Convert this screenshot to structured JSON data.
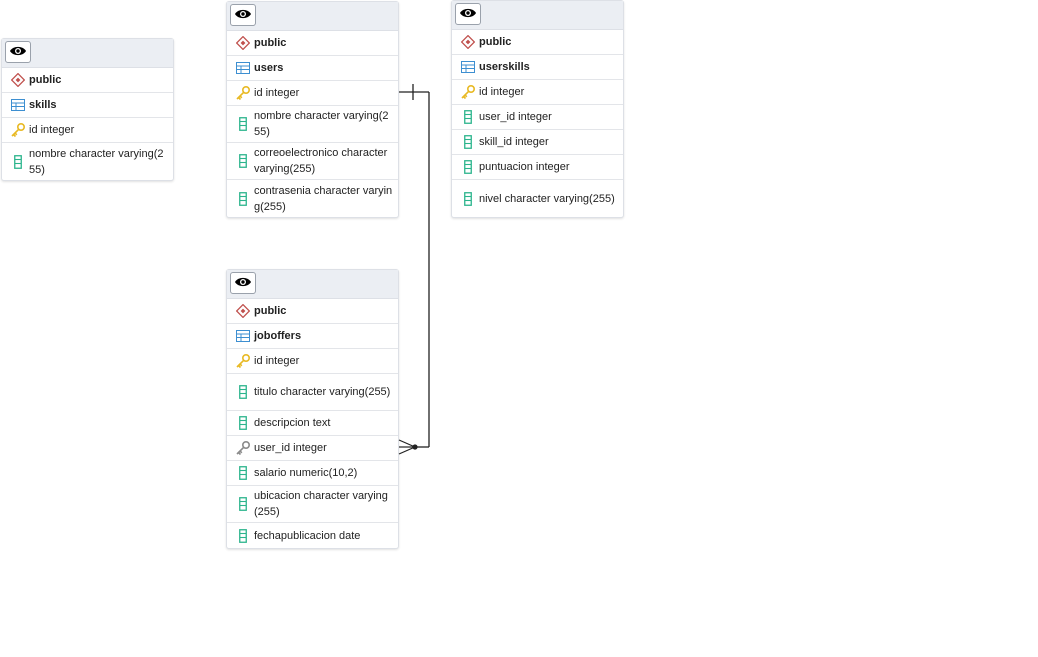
{
  "tables": [
    {
      "name": "skills",
      "schema": "public",
      "columns": [
        {
          "label": "id integer",
          "kind": "pk"
        },
        {
          "label": "nombre character varying(255)",
          "kind": "col"
        }
      ]
    },
    {
      "name": "users",
      "schema": "public",
      "columns": [
        {
          "label": "id integer",
          "kind": "pk"
        },
        {
          "label": "nombre character varying(255)",
          "kind": "col"
        },
        {
          "label": "correoelectronico character varying(255)",
          "kind": "col"
        },
        {
          "label": "contrasenia character varying(255)",
          "kind": "col"
        }
      ]
    },
    {
      "name": "userskills",
      "schema": "public",
      "columns": [
        {
          "label": "id integer",
          "kind": "pk"
        },
        {
          "label": "user_id integer",
          "kind": "col"
        },
        {
          "label": "skill_id integer",
          "kind": "col"
        },
        {
          "label": "puntuacion integer",
          "kind": "col"
        },
        {
          "label": "nivel character varying(255)",
          "kind": "col"
        }
      ]
    },
    {
      "name": "joboffers",
      "schema": "public",
      "columns": [
        {
          "label": "id integer",
          "kind": "pk"
        },
        {
          "label": "titulo character varying(255)",
          "kind": "col"
        },
        {
          "label": "descripcion text",
          "kind": "col"
        },
        {
          "label": "user_id integer",
          "kind": "fk"
        },
        {
          "label": "salario numeric(10,2)",
          "kind": "col"
        },
        {
          "label": "ubicacion character varying(255)",
          "kind": "col"
        },
        {
          "label": "fechapublicacion date",
          "kind": "col"
        }
      ]
    }
  ],
  "relationships": [
    {
      "from": "joboffers.user_id",
      "to": "users.id",
      "cardinality": "many-to-one"
    }
  ],
  "colors": {
    "schema_icon": "#c0504d",
    "table_icon": "#3d8fd1",
    "key_icon": "#e8b923",
    "fk_icon": "#8a8a8a",
    "column_icon": "#2bb48c",
    "header_bg": "#ebeef3"
  },
  "icons": {
    "view": "eye-icon",
    "schema": "schema-icon",
    "table": "table-icon",
    "pk": "primary-key-icon",
    "fk": "foreign-key-icon",
    "col": "column-icon"
  }
}
